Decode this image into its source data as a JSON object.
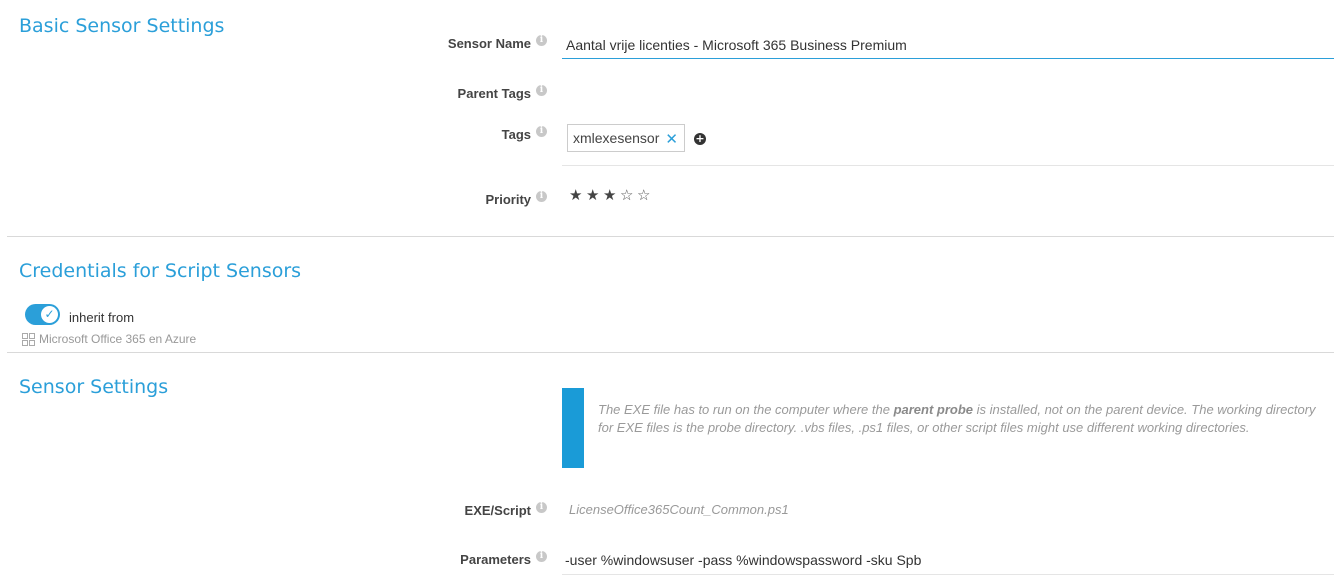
{
  "basic": {
    "title": "Basic Sensor Settings",
    "sensor_name_label": "Sensor Name",
    "sensor_name_value": "Aantal vrije licenties - Microsoft 365 Business Premium",
    "parent_tags_label": "Parent Tags",
    "tags_label": "Tags",
    "tags": [
      "xmlexesensor"
    ],
    "tag_remove": "✕",
    "tag_add": "+",
    "priority_label": "Priority",
    "priority_value": 3,
    "priority_max": 5
  },
  "credentials": {
    "title": "Credentials for Script Sensors",
    "toggle_checked": true,
    "toggle_label": "inherit from",
    "inherit_source": "Microsoft Office 365 en Azure"
  },
  "sensor_settings": {
    "title": "Sensor Settings",
    "note_pre": "The EXE file has to run on the computer where the ",
    "note_bold": "parent probe",
    "note_post": " is installed, not on the parent device. The working directory for EXE files is the probe directory. .vbs files, .ps1 files, or other script files might use different working directories.",
    "exe_label": "EXE/Script",
    "exe_value": "LicenseOffice365Count_Common.ps1",
    "params_label": "Parameters",
    "params_value": "-user %windowsuser -pass %windowspassword -sku Spb"
  },
  "colors": {
    "accent": "#2b9fd9",
    "note_bar": "#1a9bd7"
  },
  "icons": {
    "info": "info-icon",
    "tag_remove": "close-icon",
    "tag_add": "plus-circle-icon",
    "star": "star-icon",
    "toggle": "check-icon",
    "device": "device-group-icon"
  }
}
